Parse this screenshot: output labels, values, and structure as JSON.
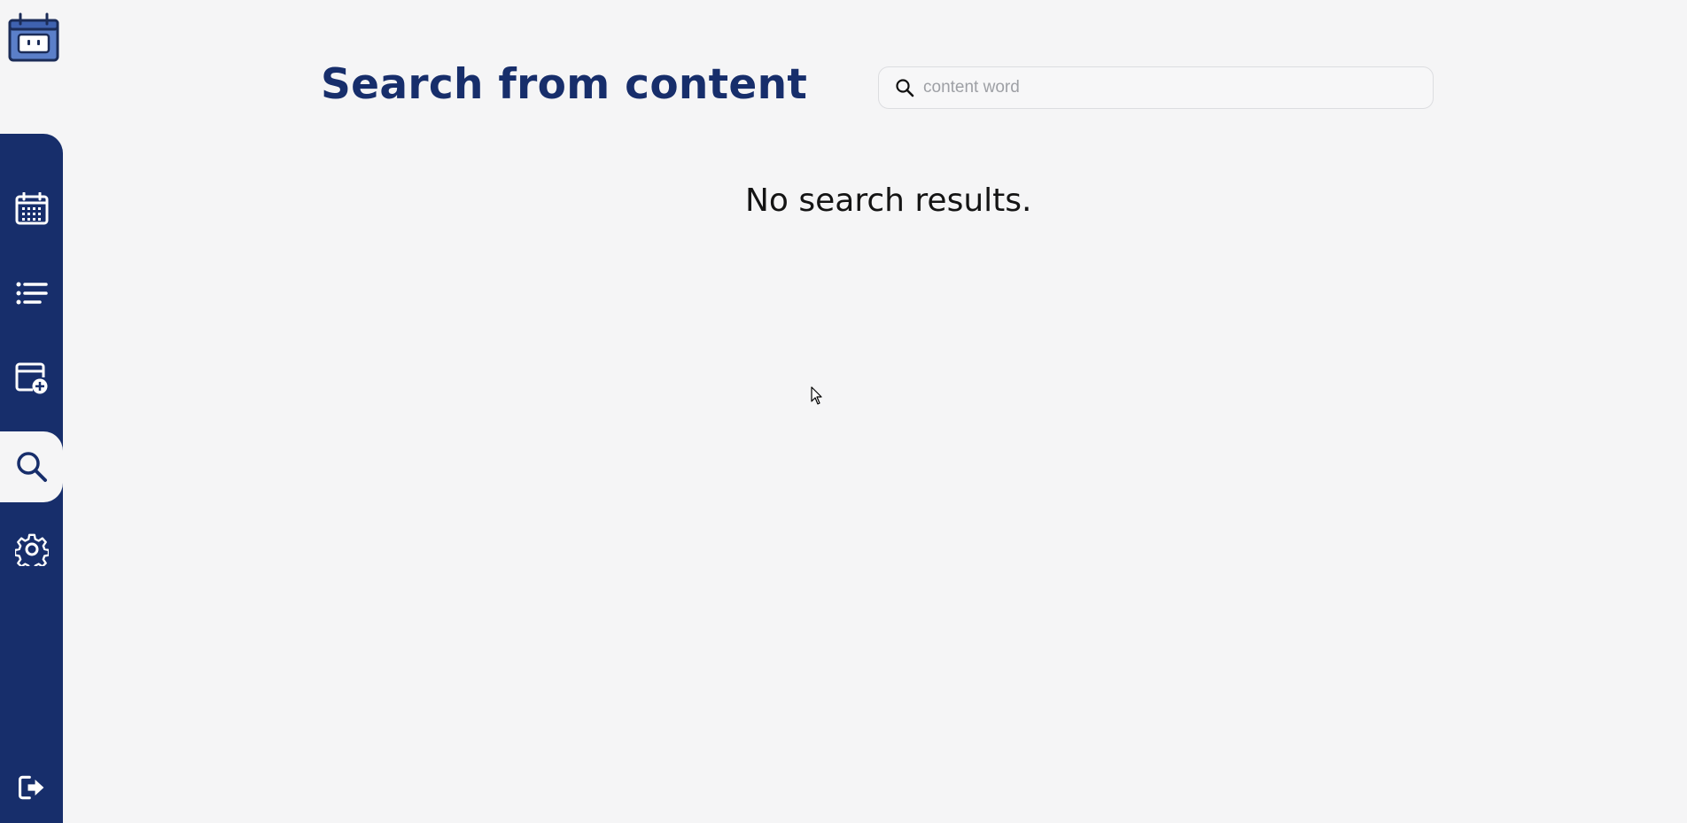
{
  "app": {
    "logo_icon": "calendar-robot-logo"
  },
  "sidebar": {
    "background": "#172e6b",
    "items": [
      {
        "name": "calendar",
        "icon": "calendar-icon",
        "active": false
      },
      {
        "name": "list",
        "icon": "list-icon",
        "active": false
      },
      {
        "name": "add-event",
        "icon": "calendar-add-icon",
        "active": false
      },
      {
        "name": "search",
        "icon": "search-icon",
        "active": true
      },
      {
        "name": "settings",
        "icon": "gear-icon",
        "active": false
      }
    ],
    "logout_icon": "logout-icon"
  },
  "header": {
    "title": "Search from content",
    "title_color": "#172e6b"
  },
  "search": {
    "placeholder": "content word",
    "value": ""
  },
  "results": {
    "empty_message": "No search results."
  }
}
